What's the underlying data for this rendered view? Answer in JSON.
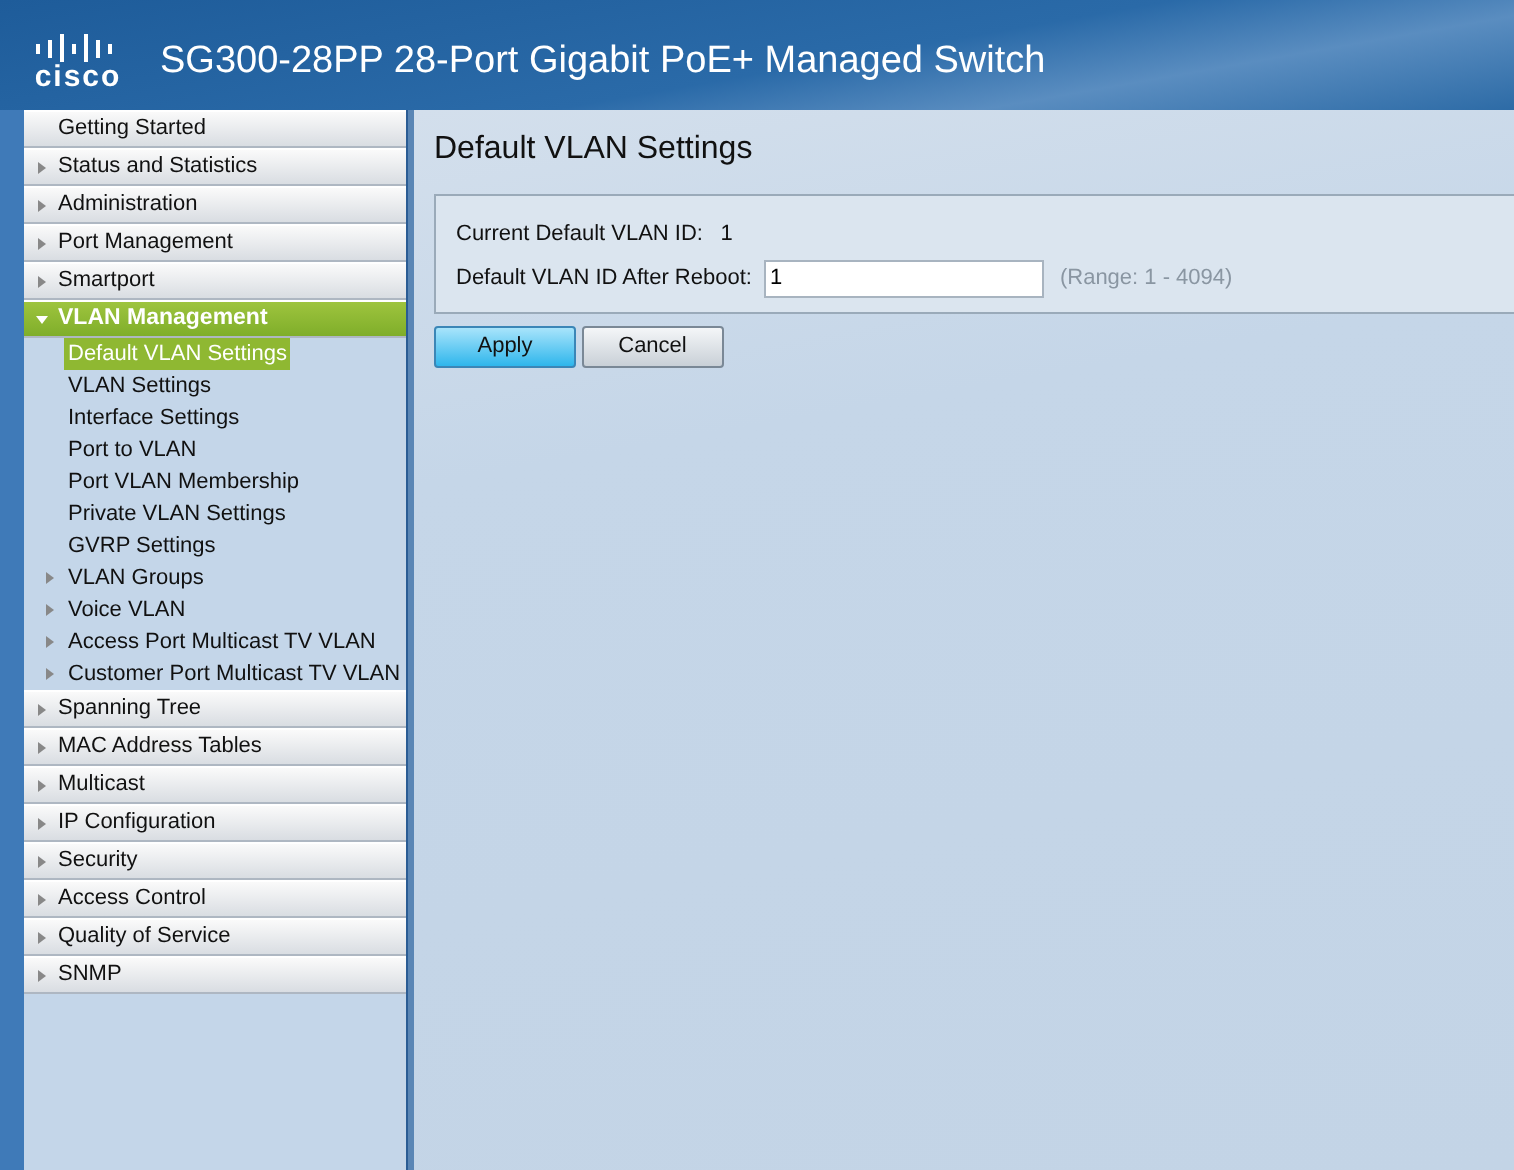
{
  "header": {
    "logo_text": "cisco",
    "title": "SG300-28PP 28-Port Gigabit PoE+ Managed Switch"
  },
  "sidebar": {
    "items": [
      {
        "label": "Getting Started",
        "expandable": false,
        "expanded": false
      },
      {
        "label": "Status and Statistics",
        "expandable": true,
        "expanded": false
      },
      {
        "label": "Administration",
        "expandable": true,
        "expanded": false
      },
      {
        "label": "Port Management",
        "expandable": true,
        "expanded": false
      },
      {
        "label": "Smartport",
        "expandable": true,
        "expanded": false
      },
      {
        "label": "VLAN Management",
        "expandable": true,
        "expanded": true,
        "children": [
          {
            "label": "Default VLAN Settings",
            "expandable": false,
            "selected": true
          },
          {
            "label": "VLAN Settings",
            "expandable": false,
            "selected": false
          },
          {
            "label": "Interface Settings",
            "expandable": false,
            "selected": false
          },
          {
            "label": "Port to VLAN",
            "expandable": false,
            "selected": false
          },
          {
            "label": "Port VLAN Membership",
            "expandable": false,
            "selected": false
          },
          {
            "label": "Private VLAN Settings",
            "expandable": false,
            "selected": false
          },
          {
            "label": "GVRP Settings",
            "expandable": false,
            "selected": false
          },
          {
            "label": "VLAN Groups",
            "expandable": true,
            "selected": false
          },
          {
            "label": "Voice VLAN",
            "expandable": true,
            "selected": false
          },
          {
            "label": "Access Port Multicast TV VLAN",
            "expandable": true,
            "selected": false
          },
          {
            "label": "Customer Port Multicast TV VLAN",
            "expandable": true,
            "selected": false
          }
        ]
      },
      {
        "label": "Spanning Tree",
        "expandable": true,
        "expanded": false
      },
      {
        "label": "MAC Address Tables",
        "expandable": true,
        "expanded": false
      },
      {
        "label": "Multicast",
        "expandable": true,
        "expanded": false
      },
      {
        "label": "IP Configuration",
        "expandable": true,
        "expanded": false
      },
      {
        "label": "Security",
        "expandable": true,
        "expanded": false
      },
      {
        "label": "Access Control",
        "expandable": true,
        "expanded": false
      },
      {
        "label": "Quality of Service",
        "expandable": true,
        "expanded": false
      },
      {
        "label": "SNMP",
        "expandable": true,
        "expanded": false
      }
    ]
  },
  "page": {
    "title": "Default VLAN Settings",
    "fields": [
      {
        "kind": "readout",
        "label": "Current Default VLAN ID:",
        "value": "1"
      },
      {
        "kind": "input",
        "label": "Default VLAN ID After Reboot:",
        "value": "1",
        "hint": "(Range: 1 - 4094)"
      }
    ],
    "buttons": [
      {
        "label": "Apply",
        "primary": true
      },
      {
        "label": "Cancel",
        "primary": false
      }
    ]
  }
}
